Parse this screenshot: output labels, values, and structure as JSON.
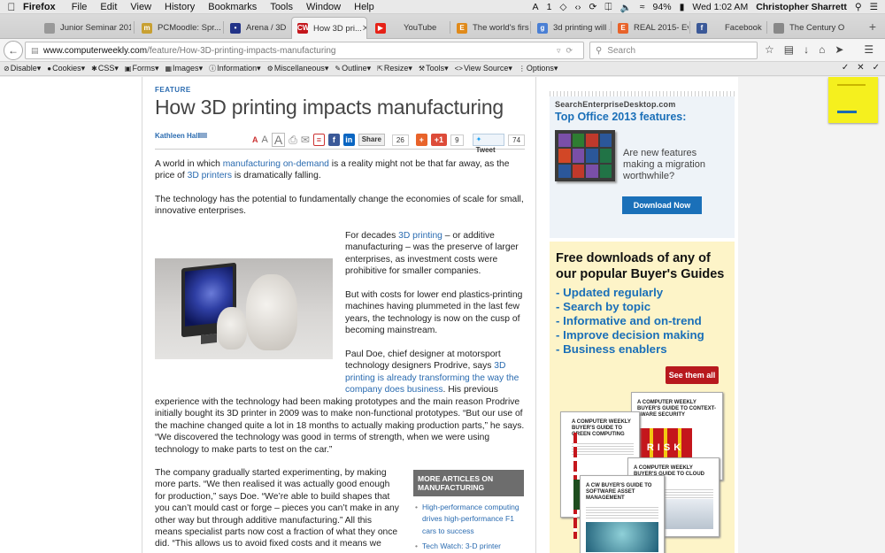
{
  "menubar": {
    "app": "Firefox",
    "items": [
      "File",
      "Edit",
      "View",
      "History",
      "Bookmarks",
      "Tools",
      "Window",
      "Help"
    ],
    "status_badge": "1",
    "battery": "94%",
    "clock": "Wed 1:02 AM",
    "user": "Christopher Sharrett"
  },
  "tabs": [
    {
      "label": "Junior Seminar 201...",
      "color": "#999999"
    },
    {
      "label": "PCMoodle: Spr...",
      "color": "#c8a032"
    },
    {
      "label": "Arena / 3D Prin...",
      "color": "#223388"
    },
    {
      "label": "How 3D pri...",
      "color": "#c4161c",
      "active": true
    },
    {
      "label": "YouTube",
      "color": "#e62117"
    },
    {
      "label": "The world's firs...",
      "color": "#e08a1a"
    },
    {
      "label": "3d printing will ...",
      "color": "#4a7fd4"
    },
    {
      "label": "REAL 2015- Ev...",
      "color": "#e8632a"
    },
    {
      "label": "Facebook",
      "color": "#3b5998"
    },
    {
      "label": "The Century Of...",
      "color": "#888888"
    }
  ],
  "navbar": {
    "url_host": "www.computerweekly.com",
    "url_path": "/feature/How-3D-printing-impacts-manufacturing",
    "search_placeholder": "Search"
  },
  "devbar": [
    "Disable",
    "Cookies",
    "CSS",
    "Forms",
    "Images",
    "Information",
    "Miscellaneous",
    "Outline",
    "Resize",
    "Tools",
    "View Source",
    "Options"
  ],
  "article": {
    "kicker": "FEATURE",
    "title": "How 3D printing impacts manufacturing",
    "author": "Kathleen Hall",
    "share": {
      "share_label": "Share",
      "share_count": "26",
      "gplus_label": "+1",
      "gplus_count": "9",
      "tweet_label": "Tweet",
      "tweet_count": "74"
    },
    "p1_a": "A world in which ",
    "p1_link1": "manufacturing on-demand",
    "p1_b": " is a reality might not be that far away, as the price of ",
    "p1_link2": "3D printers",
    "p1_c": " is dramatically falling.",
    "p2": "The technology has the potential to fundamentally change the economies of scale for small, innovative enterprises.",
    "p3_a": "For decades ",
    "p3_link": "3D printing",
    "p3_b": " – or additive manufacturing – was the preserve of larger enterprises, as investment costs were prohibitive for smaller companies.",
    "p4": "But with costs for lower end plastics-printing machines having plummeted in the last few years, the technology is now on the cusp of becoming mainstream.",
    "p5_a": "Paul Doe, chief designer at motorsport technology designers Prodrive, says ",
    "p5_link": "3D printing is already transforming the way the company does business",
    "p5_b": ". His previous",
    "p5_full": "experience with the technology had been making prototypes and the main reason Prodrive initially bought its 3D printer in 2009 was to make non-functional prototypes. “But our use of the machine changed quite a lot in 18 months to actually making production parts,” he says. “We discovered the technology was good in terms of strength, when we were using technology to make parts to test on the car.”",
    "p6": "The company gradually started experimenting, by making more parts. “We then realised it was actually good enough for production,” says Doe. “We’re able to build shapes that you can’t mould cast or forge – pieces you can’t make in any other way but through additive manufacturing.” All this means specialist parts now cost a fraction of what they once did. “This allows us to avoid fixed costs and it means we",
    "more_header": "MORE ARTICLES ON MANUFACTURING",
    "more_items": [
      "High-performance computing drives high-performance F1 cars to success",
      "Tech Watch: 3-D printer"
    ]
  },
  "ad1": {
    "site": "SearchEnterpriseDesktop.com",
    "headline": "Top Office 2013 features:",
    "question": "Are new features making a migration worthwhile?",
    "button": "Download Now"
  },
  "ad2": {
    "headline": "Free downloads of any of our popular Buyer's Guides",
    "bullets": [
      "- Updated regularly",
      "- Search by topic",
      "- Informative and on-trend",
      "- Improve decision making",
      "- Business enablers"
    ],
    "button": "See them all",
    "guides": [
      "A COMPUTER WEEKLY BUYER'S GUIDE TO CONTEXT-AWARE SECURITY",
      "A COMPUTER WEEKLY BUYER'S GUIDE TO GREEN COMPUTING",
      "A COMPUTER WEEKLY BUYER'S GUIDE TO CLOUD STORAGE",
      "A CW BUYER'S GUIDE TO SOFTWARE ASSET MANAGEMENT"
    ],
    "guide_letters": "RISK"
  }
}
